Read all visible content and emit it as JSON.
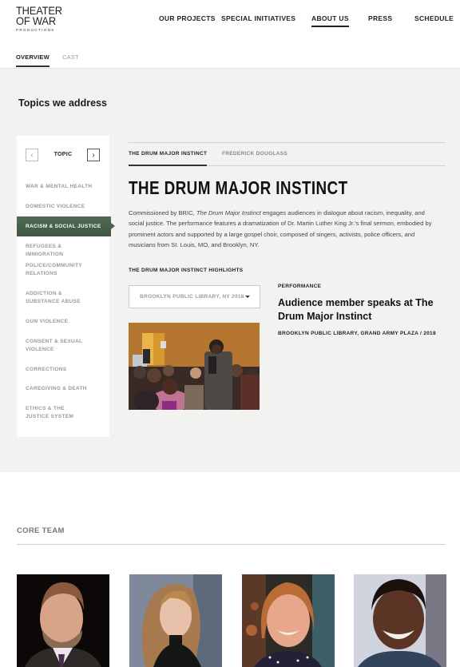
{
  "header": {
    "logo": {
      "line1": "THEATER",
      "line2": "OF WAR",
      "line3": "PRODUCTIONS"
    },
    "nav": [
      {
        "label": "OUR PROJECTS",
        "active": false
      },
      {
        "label": "SPECIAL INITIATIVES",
        "active": false
      },
      {
        "label": "ABOUT US",
        "active": true
      },
      {
        "label": "PRESS",
        "active": false
      },
      {
        "label": "SCHEDULE",
        "active": false
      }
    ],
    "subnav": [
      {
        "label": "OVERVIEW",
        "active": true
      },
      {
        "label": "CAST",
        "active": false
      }
    ]
  },
  "topics": {
    "title": "Topics we address",
    "sidebar": {
      "heading": "TOPIC",
      "prev_icon": "‹",
      "next_icon": "›",
      "items": [
        {
          "label": "WAR & MENTAL HEALTH",
          "active": false
        },
        {
          "label": "DOMESTIC VIOLENCE",
          "active": false
        },
        {
          "label": "RACISM & SOCIAL JUSTICE",
          "active": true
        },
        {
          "label": "REFUGEES & IMMIGRATION",
          "active": false
        },
        {
          "label": "POLICE/COMMUNITY RELATIONS",
          "active": false
        },
        {
          "label": "ADDICTION & SUBSTANCE ABUSE",
          "active": false
        },
        {
          "label": "GUN VIOLENCE",
          "active": false
        },
        {
          "label": "CONSENT & SEXUAL VIOLENCE",
          "active": false
        },
        {
          "label": "CORRECTIONS",
          "active": false
        },
        {
          "label": "CAREGIVING & DEATH",
          "active": false
        },
        {
          "label": "ETHICS & THE JUSTICE SYSTEM",
          "active": false
        }
      ]
    },
    "tabs": [
      {
        "label": "THE DRUM MAJOR INSTINCT",
        "active": true
      },
      {
        "label": "FREDERICK DOUGLASS",
        "active": false
      }
    ],
    "project": {
      "title": "THE DRUM MAJOR INSTINCT",
      "desc_prefix": "Commissioned by BRIC, ",
      "desc_italic": "The Drum Major Instinct",
      "desc_rest": " engages audiences in dialogue about racism, inequality, and social justice. The performance features a dramatization of Dr. Martin Luther King Jr.'s final sermon, embodied by prominent actors and supported by a large gospel choir, composed of singers, activists, police officers, and musicians from St. Louis, MO, and Brooklyn, NY.",
      "highlights_label": "THE DRUM MAJOR INSTINCT HIGHLIGHTS",
      "select_value": "BROOKLYN PUBLIC LIBRARY, NY 2018",
      "card": {
        "type": "PERFORMANCE",
        "title": "Audience member speaks at The Drum Major Instinct",
        "meta": "BROOKLYN PUBLIC LIBRARY, GRAND ARMY PLAZA / 2018"
      }
    }
  },
  "core_team": {
    "title": "CORE TEAM",
    "members": [
      {
        "photo": "man-with-beard-portrait"
      },
      {
        "photo": "woman-long-hair-portrait"
      },
      {
        "photo": "smiling-woman-portrait"
      },
      {
        "photo": "smiling-man-portrait"
      }
    ]
  },
  "colors": {
    "accent_green": "#4a634e",
    "section_bg": "#f2f3f1"
  }
}
